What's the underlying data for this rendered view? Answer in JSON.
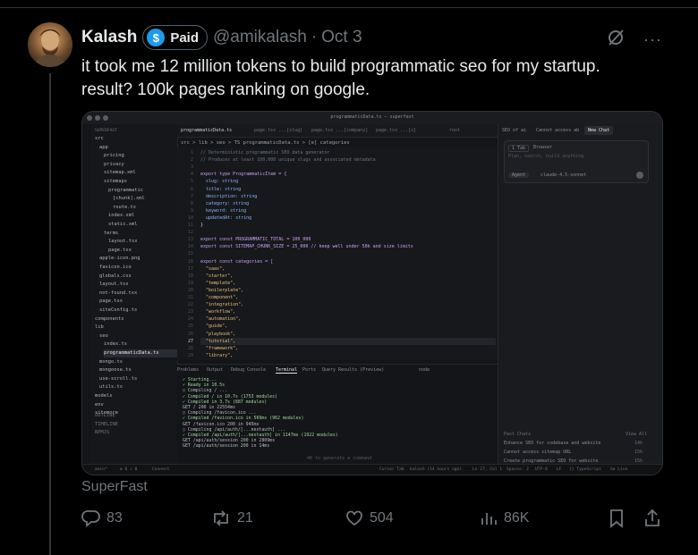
{
  "tweet": {
    "author_name": "Kalash",
    "badge_label": "Paid",
    "badge_symbol": "$",
    "handle": "@amikalash",
    "separator": "·",
    "date": "Oct 3",
    "text_lines": [
      "it took me 12 million tokens to build programmatic seo for my startup.",
      "result? 100k pages ranking on google."
    ],
    "media_caption": "SuperFast",
    "more_glyph": "···",
    "stats": {
      "replies": "83",
      "reposts": "21",
      "likes": "504",
      "views": "86K"
    }
  },
  "editor": {
    "window_title": "programmaticData.ts — superfast",
    "explorer_title": "SUPERFAST",
    "explorer_items": [
      {
        "label": "src"
      },
      {
        "label": "app"
      },
      {
        "label": "pricing"
      },
      {
        "label": "privacy"
      },
      {
        "label": "sitemap.xml"
      },
      {
        "label": "sitemaps"
      },
      {
        "label": "programmatic"
      },
      {
        "label": "[chunk].xml"
      },
      {
        "label": "route.ts"
      },
      {
        "label": "index.xml"
      },
      {
        "label": "static.xml"
      },
      {
        "label": "terms"
      },
      {
        "label": "layout.tsx"
      },
      {
        "label": "page.tsx"
      },
      {
        "label": "apple-icon.png"
      },
      {
        "label": "favicon.ico"
      },
      {
        "label": "globals.css"
      },
      {
        "label": "layout.tsx"
      },
      {
        "label": "not-found.tsx"
      },
      {
        "label": "page.tsx"
      },
      {
        "label": "siteConfig.ts"
      },
      {
        "label": "components"
      },
      {
        "label": "lib"
      },
      {
        "label": "seo"
      },
      {
        "label": "index.ts"
      },
      {
        "label": "programmaticData.ts"
      },
      {
        "label": "mongo.ts"
      },
      {
        "label": "mongoose.ts"
      },
      {
        "label": "use-scroll.ts"
      },
      {
        "label": "utils.ts"
      },
      {
        "label": "models"
      },
      {
        "label": "env"
      },
      {
        "label": "sitemore"
      },
      {
        "label": "OUTLINE"
      },
      {
        "label": "TIMELINE"
      },
      {
        "label": "NPMJS"
      }
    ],
    "tabs": [
      "programmaticData.ts",
      "page.tsx ...[slug]",
      "page.tsx ...[company]",
      "page.tsx ...[s]",
      "root"
    ],
    "breadcrumb": "src > lib > seo > TS programmaticData.ts > [e] categories",
    "code_lines": [
      "// Deterministic programmatic SEO data generator",
      "// Produces at least 100,000 unique slugs and associated metadata",
      "",
      "export type ProgrammaticItem = {",
      "  slug: string",
      "  title: string",
      "  description: string",
      "  category: string",
      "  keyword: string",
      "  updatedAt: string",
      "}",
      "",
      "export const PROGRAMMATIC_TOTAL = 100_000",
      "export const SITEMAP_CHUNK_SIZE = 25_000 // keep well under 50k and size limits",
      "",
      "export const categories = [",
      "  \"saas\",",
      "  \"starter\",",
      "  \"template\",",
      "  \"boilerplate\",",
      "  \"component\",",
      "  \"integration\",",
      "  \"workflow\",",
      "  \"automation\",",
      "  \"guide\",",
      "  \"playbook\",",
      "  \"tutorial\",",
      "  \"framework\",",
      "  \"library\","
    ],
    "panel_tabs": [
      "Problems",
      "Output",
      "Debug Console",
      "Terminal",
      "Ports",
      "Query Results (Preview)"
    ],
    "terminal_label": "node",
    "terminal_lines": [
      "✓ Starting...",
      "✓ Ready in 10.5s",
      "○ Compiling / ...",
      "✓ Compiled / in 10.7s (1753 modules)",
      "✓ Compiled in 3.7s (887 modules)",
      "GET / 200 in 22554ms",
      "○ Compiling /favicon.ico ...",
      "✓ Compiled /favicon.ico in 569ms (962 modules)",
      "GET /favicon.ico 200 in 945ms",
      "○ Compiling /api/auth/[...nextauth] ...",
      "✓ Compiled /api/auth/[...nextauth] in 1147ms (1922 modules)",
      "GET /api/auth/session 200 in 2809ms",
      "GET /api/auth/session 200 in 14ms"
    ],
    "terminal_hint": "⌘K to generate a command",
    "chat": {
      "tabs": [
        "SEO of ai",
        "Cannot access ab",
        "New Chat"
      ],
      "context_chip": "1 Tab",
      "browser_chip": "Browser",
      "input_placeholder": "Plan, search, build anything",
      "agent_label": "Agent",
      "model_label": "claude-4.5-sonnet",
      "past_chats_label": "Past Chats",
      "view_all_label": "View All",
      "past_chats": [
        {
          "title": "Enhance SEO for codebase and website",
          "age": "14h"
        },
        {
          "title": "Cannot access sitemap URL",
          "age": "15h"
        },
        {
          "title": "Create programmatic SEO for website",
          "age": "15h"
        }
      ]
    },
    "status_items": [
      "main*",
      "⊗ 0 ⚠ 0",
      "Connect",
      "Cursor Tab",
      "kalash (14 hours ago)",
      "Ln 27, Col 1",
      "Spaces: 2",
      "UTF-8",
      "LF",
      "{} TypeScript",
      "Go Live"
    ]
  }
}
